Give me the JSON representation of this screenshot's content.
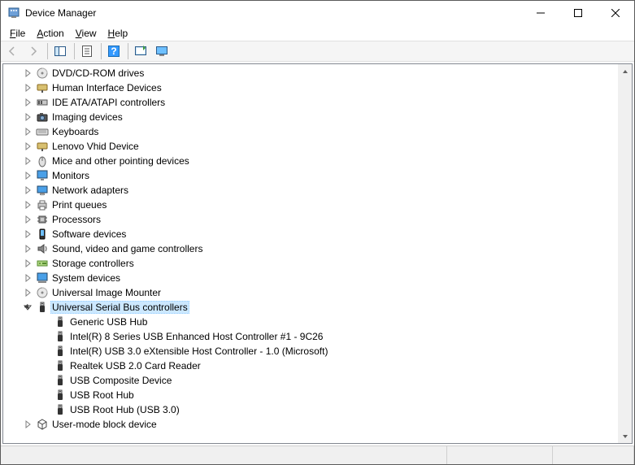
{
  "window": {
    "title": "Device Manager"
  },
  "menu": {
    "file": "File",
    "action": "Action",
    "view": "View",
    "help": "Help"
  },
  "toolbar": {
    "back": "Back",
    "forward": "Forward",
    "show_hide": "Show/Hide Console Tree",
    "properties": "Properties",
    "help": "Help",
    "scan": "Scan for hardware changes",
    "show_hidden": "Show hidden devices"
  },
  "tree": {
    "categories": [
      {
        "label": "DVD/CD-ROM drives",
        "expanded": false,
        "icon": "disc"
      },
      {
        "label": "Human Interface Devices",
        "expanded": false,
        "icon": "hid"
      },
      {
        "label": "IDE ATA/ATAPI controllers",
        "expanded": false,
        "icon": "ide"
      },
      {
        "label": "Imaging devices",
        "expanded": false,
        "icon": "imaging"
      },
      {
        "label": "Keyboards",
        "expanded": false,
        "icon": "keyboard"
      },
      {
        "label": "Lenovo Vhid Device",
        "expanded": false,
        "icon": "hid"
      },
      {
        "label": "Mice and other pointing devices",
        "expanded": false,
        "icon": "mouse"
      },
      {
        "label": "Monitors",
        "expanded": false,
        "icon": "monitor"
      },
      {
        "label": "Network adapters",
        "expanded": false,
        "icon": "network"
      },
      {
        "label": "Print queues",
        "expanded": false,
        "icon": "printer"
      },
      {
        "label": "Processors",
        "expanded": false,
        "icon": "cpu"
      },
      {
        "label": "Software devices",
        "expanded": false,
        "icon": "software"
      },
      {
        "label": "Sound, video and game controllers",
        "expanded": false,
        "icon": "sound"
      },
      {
        "label": "Storage controllers",
        "expanded": false,
        "icon": "storage"
      },
      {
        "label": "System devices",
        "expanded": false,
        "icon": "system"
      },
      {
        "label": "Universal Image Mounter",
        "expanded": false,
        "icon": "disc"
      },
      {
        "label": "Universal Serial Bus controllers",
        "expanded": true,
        "selected": true,
        "icon": "usb",
        "children": [
          {
            "label": "Generic USB Hub",
            "icon": "usb"
          },
          {
            "label": "Intel(R) 8 Series USB Enhanced Host Controller #1 - 9C26",
            "icon": "usb"
          },
          {
            "label": "Intel(R) USB 3.0 eXtensible Host Controller - 1.0 (Microsoft)",
            "icon": "usb"
          },
          {
            "label": "Realtek USB 2.0 Card Reader",
            "icon": "usb"
          },
          {
            "label": "USB Composite Device",
            "icon": "usb"
          },
          {
            "label": "USB Root Hub",
            "icon": "usb"
          },
          {
            "label": "USB Root Hub (USB 3.0)",
            "icon": "usb"
          }
        ]
      },
      {
        "label": "User-mode block device",
        "expanded": false,
        "icon": "block"
      }
    ]
  }
}
